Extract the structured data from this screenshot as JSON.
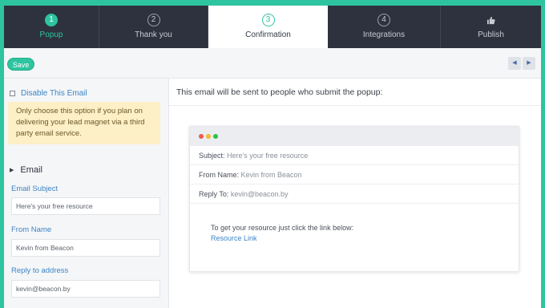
{
  "tabs": [
    {
      "number": "1",
      "label": "Popup",
      "state": "done"
    },
    {
      "number": "2",
      "label": "Thank you",
      "state": "todo"
    },
    {
      "number": "3",
      "label": "Confirmation",
      "state": "active"
    },
    {
      "number": "4",
      "label": "Integrations",
      "state": "todo"
    },
    {
      "icon": "thumbs-up-icon",
      "label": "Publish",
      "state": "todo"
    }
  ],
  "toolbar": {
    "save_label": "Save",
    "prev_icon": "chevron-left-icon",
    "next_icon": "chevron-right-icon"
  },
  "left": {
    "disable_label": "Disable This Email",
    "note": "Only choose this option if you plan on delivering your lead magnet via a third party email service.",
    "section_title": "Email",
    "subject_label": "Email Subject",
    "subject_value": "Here's your free resource",
    "from_label": "From Name",
    "from_value": "Kevin from Beacon",
    "reply_label": "Reply to address",
    "reply_value": "kevin@beacon.by"
  },
  "right": {
    "header": "This email will be sent to people who submit the popup:",
    "preview": {
      "subject_key": "Subject:",
      "subject_value": "Here's your free resource",
      "from_key": "From Name:",
      "from_value": "Kevin from Beacon",
      "reply_key": "Reply To:",
      "reply_value": "kevin@beacon.by",
      "body_text": "To get your resource just click the link below:",
      "link_text": "Resource Link"
    }
  },
  "colors": {
    "accent": "#2ec4a0",
    "tab_bg": "#2d323e",
    "link": "#3b84c4",
    "note_bg": "#fdefc6",
    "dot_red": "#ee5a52",
    "dot_yellow": "#f5bd2f",
    "dot_green": "#2fc145"
  }
}
